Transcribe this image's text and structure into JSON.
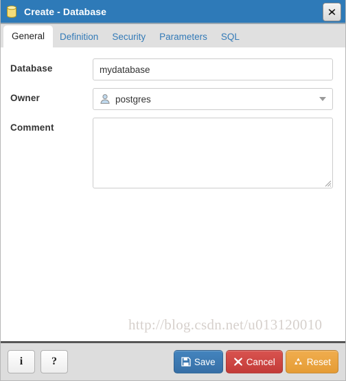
{
  "window": {
    "title": "Create - Database",
    "icon": "database-icon",
    "close_label": "✖",
    "titlebar_color": "#2e7ab8"
  },
  "tabs": [
    {
      "label": "General",
      "active": true
    },
    {
      "label": "Definition",
      "active": false
    },
    {
      "label": "Security",
      "active": false
    },
    {
      "label": "Parameters",
      "active": false
    },
    {
      "label": "SQL",
      "active": false
    }
  ],
  "form": {
    "database": {
      "label": "Database",
      "value": "mydatabase",
      "placeholder": ""
    },
    "owner": {
      "label": "Owner",
      "value": "postgres",
      "icon": "user-icon"
    },
    "comment": {
      "label": "Comment",
      "value": "",
      "placeholder": ""
    }
  },
  "watermark": "http://blog.csdn.net/u013120010",
  "footer": {
    "info_label": "i",
    "help_label": "?",
    "save_label": "Save",
    "cancel_label": "Cancel",
    "reset_label": "Reset",
    "save_color": "#3d7ebb",
    "cancel_color": "#d9534f",
    "reset_color": "#f0ad4e"
  }
}
